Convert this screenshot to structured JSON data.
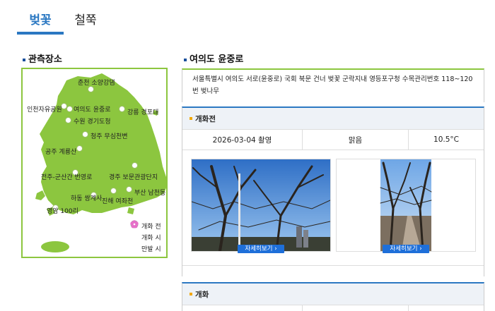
{
  "tabs": [
    {
      "label": "벚꽃",
      "active": true
    },
    {
      "label": "철쭉",
      "active": false
    }
  ],
  "left": {
    "title": "관측장소",
    "sites": [
      "춘천 소양강댐",
      "인천자유공원",
      "여의도 윤중로",
      "강릉 경포대",
      "수원 경기도청",
      "청주 무심천변",
      "공주 계룡산",
      "전주-군산간 번영로",
      "경주 보문관광단지",
      "부산 남천동",
      "하동 쌍계사",
      "진해 여좌천",
      "영암 100리"
    ],
    "legend": {
      "before": "개화 전",
      "bloom": "개화 시",
      "full": "만발 시"
    },
    "colors": {
      "before": "#ffffff",
      "bloom": "#e66fc8",
      "full": "#e66fc8",
      "land": "#8cc63f",
      "border": "#8cc63f"
    }
  },
  "right": {
    "title": "여의도 윤중로",
    "address": "서울특별시 여의도 서로(윤중로) 국회 북문 건너 벚꽃 군락지내 영등포구청 수목관리번호 118~120번 벚나무",
    "stages": [
      {
        "label": "개화전",
        "date": "2026-03-04 촬영",
        "weather": "맑음",
        "temp": "10.5°C",
        "detail_button": "자세히보기",
        "accent": "#f3a800"
      },
      {
        "label": "개화",
        "accent": "#f3a800"
      }
    ]
  }
}
